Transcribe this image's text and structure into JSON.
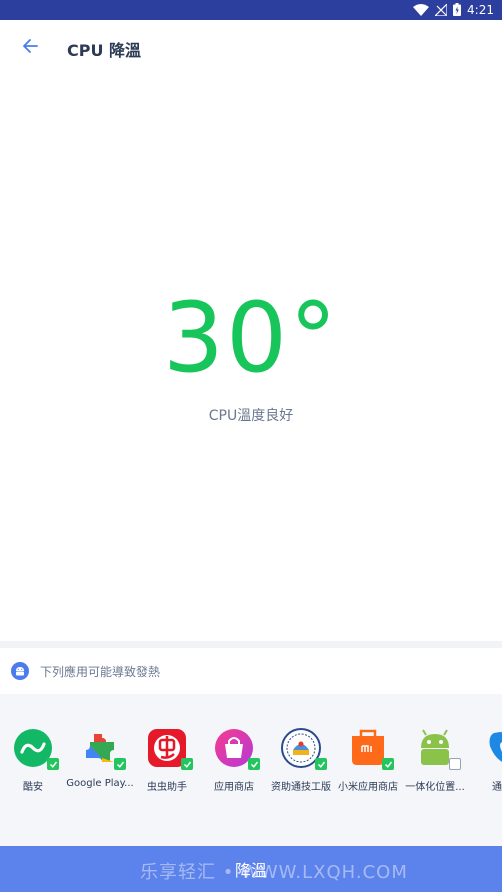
{
  "status_bar": {
    "time": "4:21"
  },
  "header": {
    "title": "CPU 降溫"
  },
  "temperature": {
    "value": "30°",
    "status": "CPU溫度良好"
  },
  "warning": {
    "text": "下列應用可能導致發熱"
  },
  "apps": [
    {
      "label": "酷安",
      "checked": true,
      "icon": "coolapk-icon"
    },
    {
      "label": "Google Play...",
      "checked": true,
      "icon": "google-play-services-icon"
    },
    {
      "label": "虫虫助手",
      "checked": true,
      "icon": "chongchong-icon"
    },
    {
      "label": "应用商店",
      "checked": true,
      "icon": "app-store-icon"
    },
    {
      "label": "资助通技工版",
      "checked": true,
      "icon": "zizhutong-icon"
    },
    {
      "label": "小米应用商店",
      "checked": true,
      "icon": "xiaomi-store-icon"
    },
    {
      "label": "一体化位置...",
      "checked": false,
      "icon": "android-icon"
    },
    {
      "label": "通话",
      "checked": true,
      "icon": "phone-icon"
    }
  ],
  "bottom_button": {
    "label": "降溫"
  },
  "watermark": {
    "text": "乐享轻汇 • WWW.LXQH.COM"
  },
  "colors": {
    "accent": "#5c82ec",
    "temp": "#18c55a",
    "status_bar": "#2c3e9e"
  }
}
